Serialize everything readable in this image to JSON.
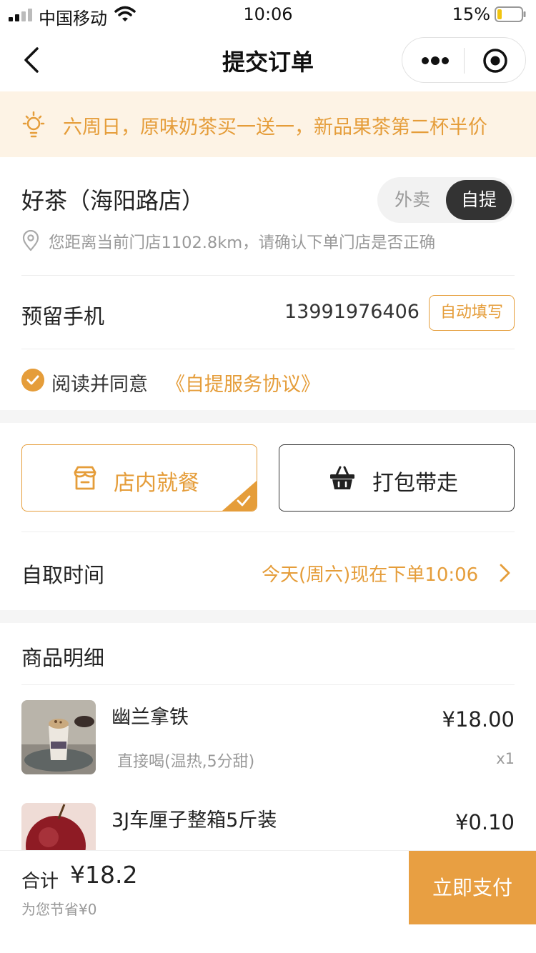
{
  "status_bar": {
    "carrier": "中国移动",
    "time": "10:06",
    "battery": "15%"
  },
  "nav": {
    "title": "提交订单"
  },
  "notice": {
    "text": "六周日，原味奶茶买一送一，新品果茶第二杯半价"
  },
  "store": {
    "name": "好茶（海阳路店）",
    "mode_options": [
      "外卖",
      "自提"
    ],
    "selected_mode": "自提",
    "distance_text": "您距离当前门店1102.8km，请确认下单门店是否正确"
  },
  "phone": {
    "label": "预留手机",
    "value": "13991976406",
    "autofill_label": "自动填写"
  },
  "agreement": {
    "text": "阅读并同意",
    "link": "《自提服务协议》"
  },
  "dining": {
    "dine_in": "店内就餐",
    "takeaway": "打包带走",
    "selected": "店内就餐"
  },
  "pickup": {
    "label": "自取时间",
    "value": "今天(周六)现在下单10:06"
  },
  "goods": {
    "title": "商品明细",
    "items": [
      {
        "name": "幽兰拿铁",
        "spec": "直接喝(温热,5分甜)",
        "price": "¥18.00",
        "qty": "x1"
      },
      {
        "name": "3J车厘子整箱5斤装",
        "spec": "",
        "price": "¥0.10",
        "qty": ""
      }
    ]
  },
  "bottom_bar": {
    "total_label": "合计",
    "total_value": "¥18.2",
    "saved": "为您节省¥0",
    "pay_label": "立即支付"
  },
  "colors": {
    "accent": "#e59d3a",
    "pay_button": "#e89f42",
    "notice_bg": "#fdf3e5",
    "dark": "#333333"
  }
}
